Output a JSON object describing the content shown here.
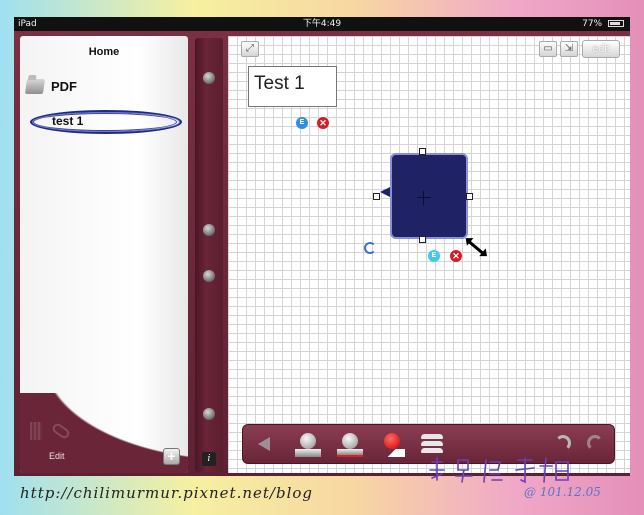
{
  "status_bar": {
    "device": "iPad",
    "time": "下午4:49",
    "battery": "77%"
  },
  "sidebar": {
    "title": "Home",
    "items": [
      {
        "label": "PDF",
        "icon": "folder-icon"
      },
      {
        "label": "test 1",
        "icon": "speech-bubble-icon",
        "selected": true
      }
    ],
    "edit_label": "Edit",
    "add_label": "+"
  },
  "spine": {
    "info_label": "i"
  },
  "canvas": {
    "edit_button": "edit",
    "text_box": "Test 1",
    "edit_badge": "E",
    "shape_color": "#1f2366"
  },
  "watermark": {
    "url": "http://chilimurmur.pixnet.net/blog",
    "date": "@ 101.12.05",
    "signature": "糯米隨手拍"
  },
  "colors": {
    "leather": "#6b2538",
    "accent_blue": "#2f8fdc",
    "delete_red": "#d21e2a"
  }
}
